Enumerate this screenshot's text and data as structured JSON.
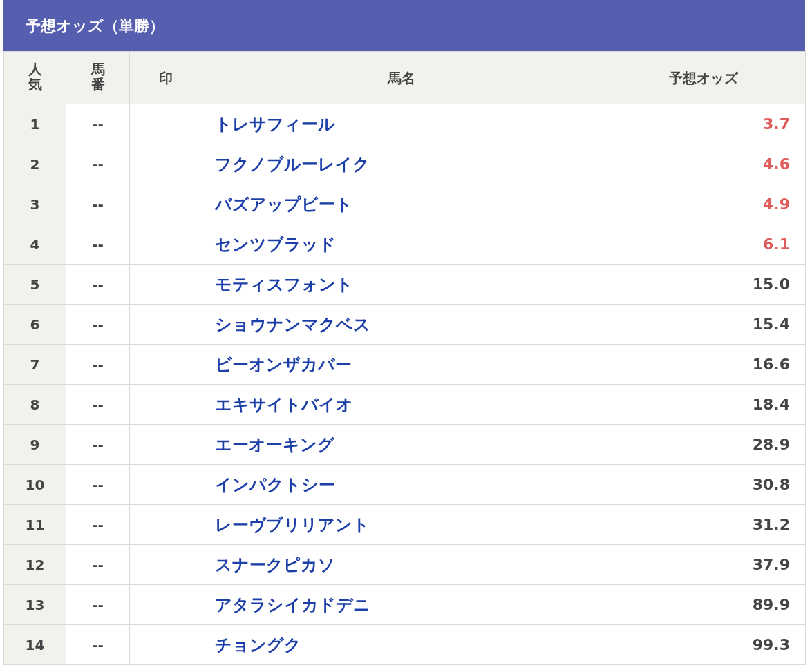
{
  "title": "予想オッズ（単勝）",
  "columns": [
    {
      "label": "人気",
      "vertical": true
    },
    {
      "label": "馬番",
      "vertical": true
    },
    {
      "label": "印",
      "vertical": false
    },
    {
      "label": "馬名",
      "vertical": false
    },
    {
      "label": "予想オッズ",
      "vertical": false
    }
  ],
  "rows": [
    {
      "rank": "1",
      "number": "--",
      "name": "トレサフィール",
      "odds": "3.7",
      "highlighted": true
    },
    {
      "rank": "2",
      "number": "--",
      "name": "フクノブルーレイク",
      "odds": "4.6",
      "highlighted": true
    },
    {
      "rank": "3",
      "number": "--",
      "name": "バズアップビート",
      "odds": "4.9",
      "highlighted": true
    },
    {
      "rank": "4",
      "number": "--",
      "name": "センツブラッド",
      "odds": "6.1",
      "highlighted": true
    },
    {
      "rank": "5",
      "number": "--",
      "name": "モティスフォント",
      "odds": "15.0",
      "highlighted": false
    },
    {
      "rank": "6",
      "number": "--",
      "name": "ショウナンマクベス",
      "odds": "15.4",
      "highlighted": false
    },
    {
      "rank": "7",
      "number": "--",
      "name": "ビーオンザカバー",
      "odds": "16.6",
      "highlighted": false
    },
    {
      "rank": "8",
      "number": "--",
      "name": "エキサイトバイオ",
      "odds": "18.4",
      "highlighted": false
    },
    {
      "rank": "9",
      "number": "--",
      "name": "エーオーキング",
      "odds": "28.9",
      "highlighted": false
    },
    {
      "rank": "10",
      "number": "--",
      "name": "インパクトシー",
      "odds": "30.8",
      "highlighted": false
    },
    {
      "rank": "11",
      "number": "--",
      "name": "レーヴブリリアント",
      "odds": "31.2",
      "highlighted": false
    },
    {
      "rank": "12",
      "number": "--",
      "name": "スナークピカソ",
      "odds": "37.9",
      "highlighted": false
    },
    {
      "rank": "13",
      "number": "--",
      "name": "アタラシイカドデニ",
      "odds": "89.9",
      "highlighted": false
    },
    {
      "rank": "14",
      "number": "--",
      "name": "チョングク",
      "odds": "99.3",
      "highlighted": false
    }
  ]
}
